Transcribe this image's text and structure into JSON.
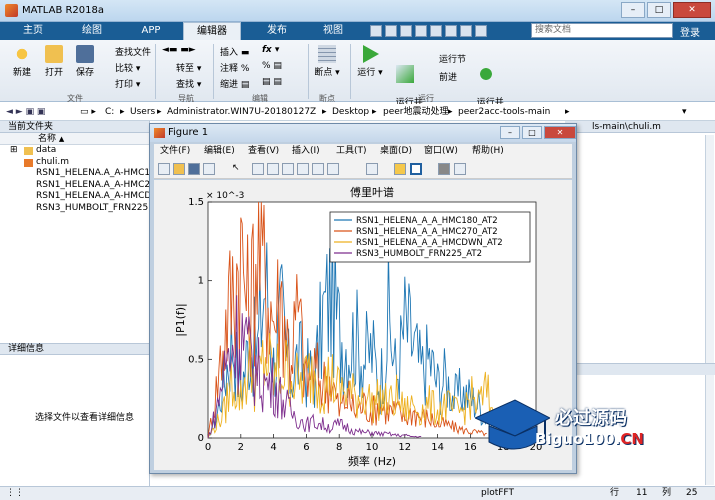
{
  "window": {
    "title": "MATLAB R2018a",
    "login_label": "登录",
    "search_placeholder": "搜索文档"
  },
  "main_tabs": [
    {
      "label": "主页"
    },
    {
      "label": "绘图"
    },
    {
      "label": "APP"
    },
    {
      "label": "编辑器"
    },
    {
      "label": "发布"
    },
    {
      "label": "视图"
    }
  ],
  "ribbon": {
    "file": {
      "new": "新建",
      "open": "打开",
      "save": "保存",
      "find_files": "查找文件",
      "compare": "比较",
      "print": "打印",
      "group": "文件"
    },
    "navigate": {
      "goto": "转至",
      "find": "查找",
      "group": "导航"
    },
    "edit": {
      "insert": "插入",
      "comment": "注释",
      "indent": "缩进",
      "fx": "fx",
      "group": "编辑"
    },
    "breakpoints": {
      "label": "断点",
      "group": "断点"
    },
    "run": {
      "run": "运行",
      "run_advance": "运行并\n前进",
      "run_section": "运行节",
      "advance": "前进",
      "run_time": "运行并\n计时",
      "group": "运行"
    }
  },
  "address": {
    "drive": "C:",
    "segments": [
      "Users",
      "Administrator.WIN7U-20180127Z",
      "Desktop",
      "peer地震动处理",
      "peer2acc-tools-main"
    ]
  },
  "current_folder": {
    "title": "当前文件夹",
    "col_name": "名称",
    "col_arrow": "▲",
    "items": [
      {
        "name": "data",
        "kind": "folder"
      },
      {
        "name": "chuli.m",
        "kind": "m"
      },
      {
        "name": "RSN1_HELENA.A_A-HMC180",
        "kind": "txt"
      },
      {
        "name": "RSN1_HELENA.A_A-HMC270",
        "kind": "txt"
      },
      {
        "name": "RSN1_HELENA.A_A-HMCDWN",
        "kind": "txt"
      },
      {
        "name": "RSN3_HUMBOLT_FRN225",
        "kind": "txt"
      }
    ]
  },
  "details": {
    "title": "详细信息",
    "message": "选择文件以查看详细信息"
  },
  "editor_path": "ls-main\\chuli.m",
  "status": {
    "script": "plotFFT",
    "row_label": "行",
    "row": "11",
    "col_label": "列",
    "col": "25"
  },
  "figure": {
    "title": "Figure 1",
    "menus": [
      "文件(F)",
      "编辑(E)",
      "查看(V)",
      "插入(I)",
      "工具(T)",
      "桌面(D)",
      "窗口(W)",
      "帮助(H)"
    ]
  },
  "chart_data": {
    "type": "line",
    "title": "傅里叶谱",
    "xlabel": "频率 (Hz)",
    "ylabel": "|P1(f)|",
    "y_exponent": "× 10^-3",
    "xlim": [
      0,
      20
    ],
    "ylim": [
      0,
      0.0015
    ],
    "xticks": [
      "0",
      "2",
      "4",
      "6",
      "8",
      "10",
      "12",
      "14",
      "16",
      "18",
      "20"
    ],
    "yticks": [
      "0",
      "0.5",
      "1",
      "1.5"
    ],
    "legend_position": "top-right",
    "series": [
      {
        "name": "RSN1_HELENA_A_A_HMC180_AT2",
        "color": "#1f77b4",
        "x": [
          0,
          0.5,
          1,
          1.5,
          2,
          2.5,
          3,
          3.5,
          4,
          4.5,
          5,
          5.5,
          6,
          6.5,
          7,
          7.5,
          8,
          8.5,
          9,
          9.5,
          10,
          10.5,
          11,
          11.5,
          12,
          12.5,
          13,
          13.5,
          14,
          14.5,
          15,
          15.5,
          16,
          16.5,
          17,
          17.5
        ],
        "y": [
          0,
          0.00015,
          0.00045,
          0.00075,
          0.00035,
          0.0007,
          0.00065,
          0.0012,
          0.00055,
          0.0009,
          0.00045,
          0.0006,
          0.0005,
          0.00045,
          0.0009,
          0.0011,
          0.0008,
          0.0007,
          0.00075,
          0.0006,
          0.00065,
          0.0004,
          0.0009,
          0.00045,
          0.00085,
          0.0007,
          0.0005,
          0.0006,
          0.0004,
          0.00045,
          0.0003,
          0.00035,
          0.0003,
          0.00025,
          0.00015,
          5e-05
        ]
      },
      {
        "name": "RSN1_HELENA_A_A_HMC270_AT2",
        "color": "#d95319",
        "x": [
          0,
          0.5,
          1,
          1.5,
          2,
          2.5,
          3,
          3.5,
          4,
          4.5,
          5,
          5.5,
          6,
          6.5,
          7,
          7.5,
          8,
          8.5,
          9,
          9.5,
          10,
          10.5,
          11,
          11.5,
          12,
          12.5,
          13,
          13.5,
          14,
          14.5,
          15,
          15.5,
          16,
          16.5,
          17
        ],
        "y": [
          0,
          0.00035,
          0.0008,
          0.0011,
          0.0014,
          0.0009,
          0.00145,
          0.0012,
          0.0009,
          0.00105,
          0.0006,
          0.00095,
          0.0004,
          0.0005,
          0.0004,
          0.00045,
          0.0002,
          0.0003,
          0.0002,
          0.00025,
          0.0002,
          0.00025,
          0.0002,
          0.0002,
          0.00015,
          0.0002,
          0.00015,
          0.00015,
          0.0001,
          0.0001,
          8e-05,
          6e-05,
          5e-05,
          4e-05,
          3e-05
        ]
      },
      {
        "name": "RSN1_HELENA_A_A_HMCDWN_AT2",
        "color": "#edb120",
        "x": [
          0,
          0.5,
          1,
          1.5,
          2,
          2.5,
          3,
          3.5,
          4,
          4.5,
          5,
          5.5,
          6,
          6.5,
          7,
          7.5,
          8,
          8.5,
          9,
          9.5,
          10,
          10.5,
          11,
          11.5,
          12,
          12.5,
          13,
          13.5,
          14,
          14.5,
          15,
          15.5,
          16,
          16.5,
          17,
          17.5,
          18
        ],
        "y": [
          0,
          0.0001,
          0.0002,
          0.00045,
          0.0003,
          0.00055,
          0.0004,
          0.0006,
          0.00045,
          0.0005,
          0.0005,
          0.0004,
          0.00045,
          0.0005,
          0.0004,
          0.00045,
          0.00035,
          0.00035,
          0.0003,
          0.00035,
          0.00025,
          0.0003,
          0.00025,
          0.0003,
          0.0002,
          0.00025,
          0.0002,
          0.00025,
          0.0002,
          0.00025,
          0.0002,
          0.0002,
          0.0003,
          0.00025,
          0.00035,
          0.00015,
          5e-05
        ]
      },
      {
        "name": "RSN3_HUMBOLT_FRN225_AT2",
        "color": "#7e2f8e",
        "x": [
          0,
          0.5,
          1,
          1.5,
          2,
          2.5,
          3,
          3.5,
          4,
          4.5,
          5,
          5.5,
          6,
          6.5,
          7,
          7.5,
          8,
          8.5,
          9,
          9.5,
          10,
          10.5,
          11,
          11.5,
          12,
          12.5,
          13
        ],
        "y": [
          0,
          0.0002,
          0.0005,
          0.0007,
          0.0008,
          0.0006,
          0.0005,
          0.0004,
          0.0004,
          0.0003,
          0.0002,
          0.00015,
          0.0001,
          0.00012,
          0.0001,
          8e-05,
          0.0001,
          8e-05,
          5e-05,
          4e-05,
          4e-05,
          3e-05,
          3e-05,
          2e-05,
          2e-05,
          1e-05,
          1e-05
        ]
      }
    ]
  },
  "watermark": {
    "brand_cn": "必过源码",
    "brand_en": "Biguo100.",
    "brand_en_red": "CN"
  }
}
